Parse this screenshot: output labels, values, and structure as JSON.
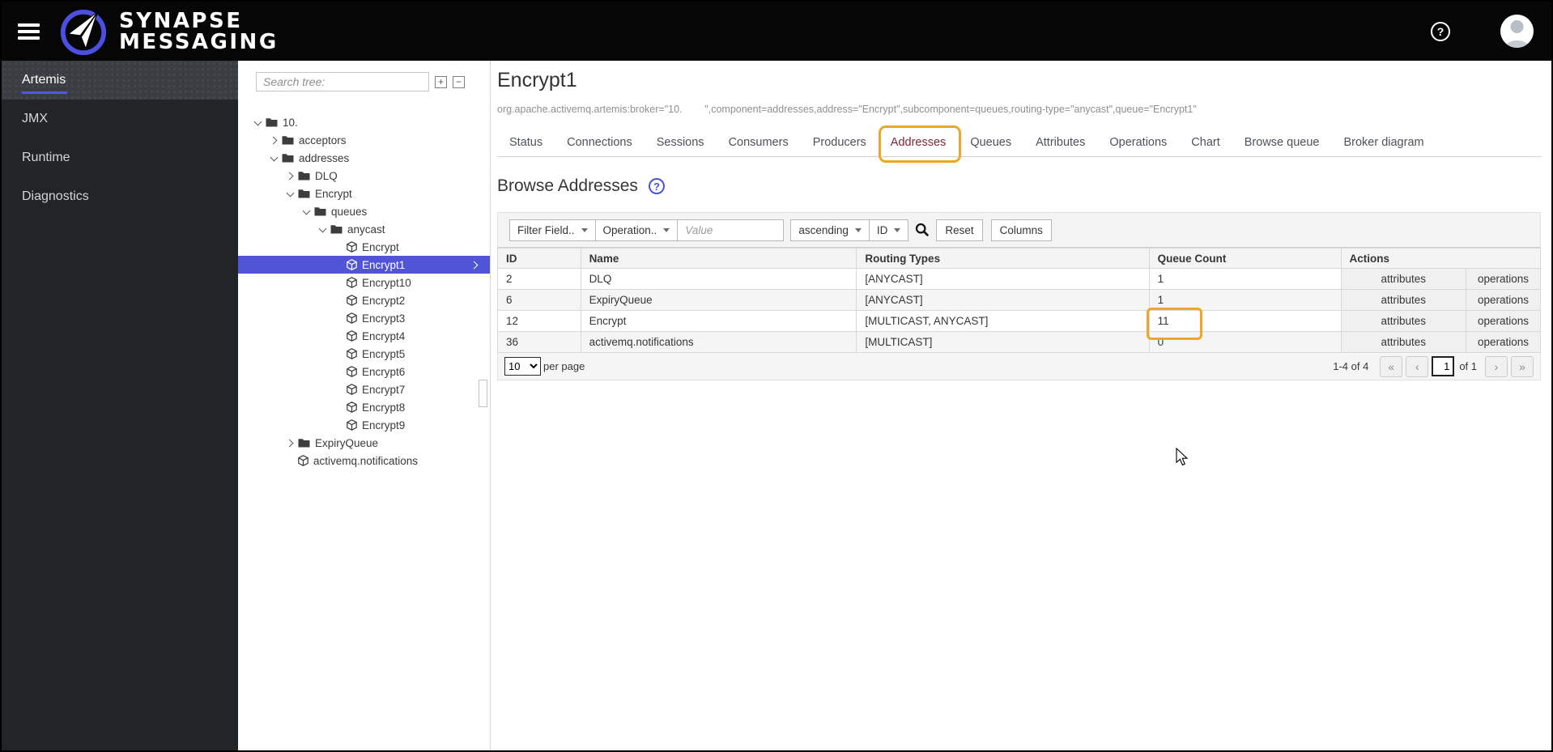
{
  "topbar": {
    "brand_line1": "SYNAPSE",
    "brand_line2": "MESSAGING"
  },
  "sidebar": {
    "items": [
      {
        "label": "Artemis",
        "active": true
      },
      {
        "label": "JMX",
        "active": false
      },
      {
        "label": "Runtime",
        "active": false
      },
      {
        "label": "Diagnostics",
        "active": false
      }
    ]
  },
  "tree": {
    "search_placeholder": "Search tree:",
    "expand_all_glyph": "+",
    "collapse_all_glyph": "−",
    "nodes": [
      {
        "label": "10.",
        "level": 0,
        "kind": "folder",
        "state": "expanded"
      },
      {
        "label": "acceptors",
        "level": 1,
        "kind": "folder",
        "state": "collapsed"
      },
      {
        "label": "addresses",
        "level": 1,
        "kind": "folder",
        "state": "expanded"
      },
      {
        "label": "DLQ",
        "level": 2,
        "kind": "folder",
        "state": "collapsed"
      },
      {
        "label": "Encrypt",
        "level": 2,
        "kind": "folder",
        "state": "expanded"
      },
      {
        "label": "queues",
        "level": 3,
        "kind": "folder",
        "state": "expanded"
      },
      {
        "label": "anycast",
        "level": 4,
        "kind": "folder",
        "state": "expanded"
      },
      {
        "label": "Encrypt",
        "level": 5,
        "kind": "leaf"
      },
      {
        "label": "Encrypt1",
        "level": 5,
        "kind": "leaf",
        "selected": true
      },
      {
        "label": "Encrypt10",
        "level": 5,
        "kind": "leaf"
      },
      {
        "label": "Encrypt2",
        "level": 5,
        "kind": "leaf"
      },
      {
        "label": "Encrypt3",
        "level": 5,
        "kind": "leaf"
      },
      {
        "label": "Encrypt4",
        "level": 5,
        "kind": "leaf"
      },
      {
        "label": "Encrypt5",
        "level": 5,
        "kind": "leaf"
      },
      {
        "label": "Encrypt6",
        "level": 5,
        "kind": "leaf"
      },
      {
        "label": "Encrypt7",
        "level": 5,
        "kind": "leaf"
      },
      {
        "label": "Encrypt8",
        "level": 5,
        "kind": "leaf"
      },
      {
        "label": "Encrypt9",
        "level": 5,
        "kind": "leaf"
      },
      {
        "label": "ExpiryQueue",
        "level": 2,
        "kind": "folder",
        "state": "collapsed"
      },
      {
        "label": "activemq.notifications",
        "level": 2,
        "kind": "leaf"
      }
    ]
  },
  "main": {
    "title": "Encrypt1",
    "mbean": "org.apache.activemq.artemis:broker=\"10.        \",component=addresses,address=\"Encrypt\",subcomponent=queues,routing-type=\"anycast\",queue=\"Encrypt1\"",
    "tabs": [
      {
        "label": "Status"
      },
      {
        "label": "Connections"
      },
      {
        "label": "Sessions"
      },
      {
        "label": "Consumers"
      },
      {
        "label": "Producers"
      },
      {
        "label": "Addresses",
        "active": true
      },
      {
        "label": "Queues"
      },
      {
        "label": "Attributes"
      },
      {
        "label": "Operations"
      },
      {
        "label": "Chart"
      },
      {
        "label": "Browse queue"
      },
      {
        "label": "Broker diagram"
      }
    ],
    "section_title": "Browse Addresses",
    "toolbar": {
      "filter_field_label": "Filter Field..",
      "operation_label": "Operation..",
      "value_placeholder": "Value",
      "sort_order_label": "ascending",
      "sort_by_label": "ID",
      "reset_label": "Reset",
      "columns_label": "Columns"
    },
    "table": {
      "columns": [
        "ID",
        "Name",
        "Routing Types",
        "Queue Count",
        "Actions"
      ],
      "action_labels": [
        "attributes",
        "operations"
      ],
      "rows": [
        {
          "id": "2",
          "name": "DLQ",
          "routing_types": "[ANYCAST]",
          "queue_count": "1",
          "highlighted": false
        },
        {
          "id": "6",
          "name": "ExpiryQueue",
          "routing_types": "[ANYCAST]",
          "queue_count": "1",
          "highlighted": false
        },
        {
          "id": "12",
          "name": "Encrypt",
          "routing_types": "[MULTICAST, ANYCAST]",
          "queue_count": "11",
          "highlighted": true
        },
        {
          "id": "36",
          "name": "activemq.notifications",
          "routing_types": "[MULTICAST]",
          "queue_count": "0",
          "highlighted": false
        }
      ]
    },
    "pagination": {
      "page_size": "10",
      "per_page_label": "per page",
      "range_label": "1-4 of 4",
      "current_page": "1",
      "of_label": "of 1",
      "first_glyph": "«",
      "prev_glyph": "‹",
      "next_glyph": "›",
      "last_glyph": "»"
    }
  },
  "colors": {
    "accent": "#5254d8",
    "annotation": "#eca62b",
    "active_tab_text": "#7d2935",
    "topbar_bg": "#060606",
    "sidebar_bg": "#222527"
  }
}
